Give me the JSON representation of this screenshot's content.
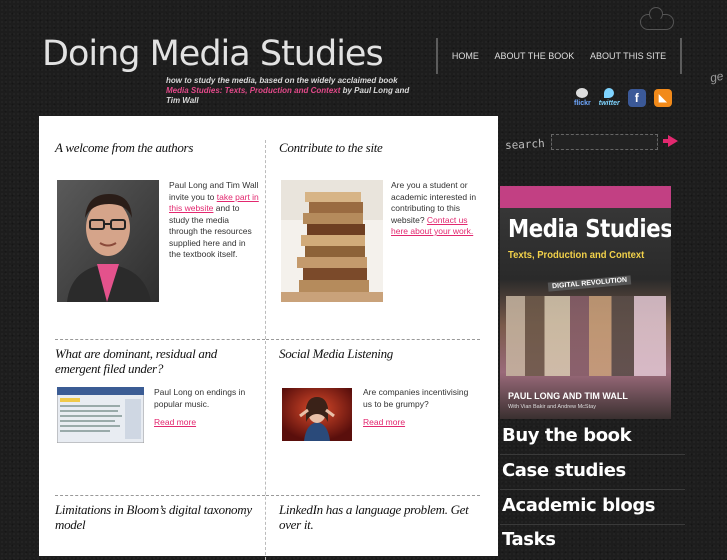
{
  "header": {
    "title": "Doing Media Studies",
    "tagline_plain": "how to study the media, based on the widely acclaimed book ",
    "tagline_book": "Media Studies: Texts, Production and Context",
    "tagline_end": " by Paul Long and Tim Wall"
  },
  "nav": [
    {
      "label": "HOME"
    },
    {
      "label": "ABOUT THE BOOK"
    },
    {
      "label": "ABOUT THIS SITE"
    }
  ],
  "social": {
    "flickr": "flickr",
    "twitter": "twitter",
    "facebook": "f",
    "rss": "◣",
    "get": "ge"
  },
  "posts": [
    {
      "title": "A welcome from the authors",
      "text_before": "Paul Long and Tim Wall invite you to ",
      "link": "take part in this website",
      "text_after": " and to study the media through the resources supplied here and in the textbook itself."
    },
    {
      "title": "Contribute to the site",
      "text_before": "Are you a student or academic interested in contributing to this website? ",
      "link": "Contact us here about your work.",
      "text_after": ""
    },
    {
      "title": "What are dominant, residual and emergent filed under?",
      "text": "Paul Long on endings in popular music.",
      "more": "Read more"
    },
    {
      "title": "Social Media Listening",
      "text": "Are companies incentivising us to be grumpy?",
      "more": "Read more"
    },
    {
      "title": "Limitations in Bloom’s digital taxonomy model"
    },
    {
      "title": "LinkedIn has a language problem. Get over it."
    }
  ],
  "search": {
    "label": "search",
    "value": ""
  },
  "book": {
    "title": "Media Studies",
    "subtitle": "Texts, Production and Context",
    "tag": "DIGITAL REVOLUTION",
    "authors": "PAUL LONG AND TIM WALL",
    "contributors": "With Vian Bakir and Andrew McStay"
  },
  "sidebar_links": [
    {
      "label": "Buy the book"
    },
    {
      "label": "Case studies"
    },
    {
      "label": "Academic blogs"
    },
    {
      "label": "Tasks"
    }
  ],
  "colors": {
    "accent": "#e2286f",
    "background": "#1d1d1d"
  }
}
